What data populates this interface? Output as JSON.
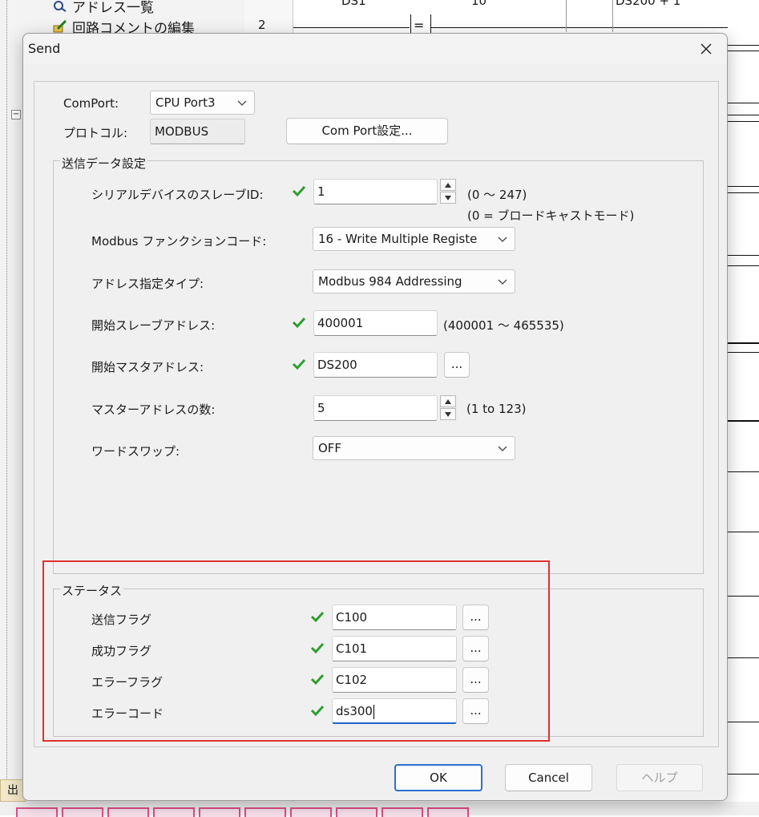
{
  "background": {
    "tree_items": [
      "アドレス一覧",
      "回路コメントの編集"
    ],
    "row_number": "2",
    "ladder_labels": [
      "DS1",
      "10",
      "DS200 + 1"
    ],
    "compare_op": "=",
    "bottom_tab": "出"
  },
  "dialog": {
    "title": "Send",
    "comport_label": "ComPort:",
    "comport_value": "CPU Port3",
    "protocol_label": "プロトコル:",
    "protocol_value": "MODBUS",
    "comport_settings_button": "Com Port設定...",
    "send_group_title": "送信データ設定",
    "slave_id_label": "シリアルデバイスのスレーブID:",
    "slave_id_value": "1",
    "slave_id_range": "(0 ～ 247)",
    "slave_id_note": "(0 = ブロードキャストモード)",
    "function_code_label": "Modbus ファンクションコード:",
    "function_code_value": "16 - Write Multiple Registe",
    "addressing_label": "アドレス指定タイプ:",
    "addressing_value": "Modbus 984 Addressing",
    "start_slave_label": "開始スレーブアドレス:",
    "start_slave_value": "400001",
    "start_slave_range": "(400001 ～ 465535)",
    "start_master_label": "開始マスタアドレス:",
    "start_master_value": "DS200",
    "master_count_label": "マスターアドレスの数:",
    "master_count_value": "5",
    "master_count_range": "(1 to 123)",
    "word_swap_label": "ワードスワップ:",
    "word_swap_value": "OFF",
    "browse_label": "...",
    "status_group_title": "ステータス",
    "status_rows": [
      {
        "label": "送信フラグ",
        "value": "C100"
      },
      {
        "label": "成功フラグ",
        "value": "C101"
      },
      {
        "label": "エラーフラグ",
        "value": "C102"
      },
      {
        "label": "エラーコード",
        "value": "ds300"
      }
    ],
    "ok_button": "OK",
    "cancel_button": "Cancel",
    "help_button": "ヘルプ"
  },
  "colors": {
    "check_green": "#2e9e2e",
    "highlight_red": "#e03030",
    "focus_blue": "#1f64c8"
  }
}
